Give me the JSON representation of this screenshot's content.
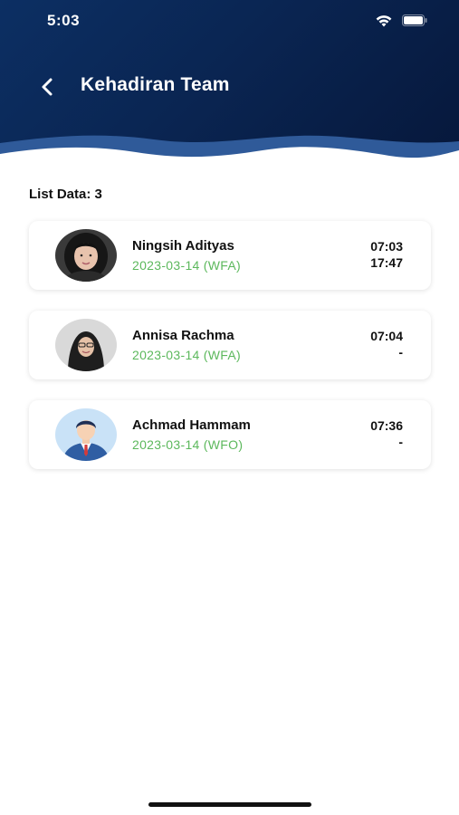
{
  "status_bar": {
    "time": "5:03",
    "wifi_icon": "wifi-icon",
    "battery_icon": "battery-icon"
  },
  "header": {
    "title": "Kehadiran Team",
    "back_icon": "chevron-left-icon",
    "colors": {
      "dark": "#06173a",
      "navy": "#0c2f63",
      "wave": "#2f5a99"
    }
  },
  "list": {
    "count_label": "List Data: 3",
    "items": [
      {
        "name": "Ningsih Adityas",
        "meta": "2023-03-14 (WFA)",
        "time_in": "07:03",
        "time_out": "17:47",
        "avatar": "avatar-photo-woman"
      },
      {
        "name": "Annisa Rachma",
        "meta": "2023-03-14 (WFA)",
        "time_in": "07:04",
        "time_out": "-",
        "avatar": "avatar-photo-hijab"
      },
      {
        "name": "Achmad Hammam",
        "meta": "2023-03-14 (WFO)",
        "time_in": "07:36",
        "time_out": "-",
        "avatar": "avatar-illustration-man"
      }
    ]
  },
  "accent_green": "#5cb85c"
}
